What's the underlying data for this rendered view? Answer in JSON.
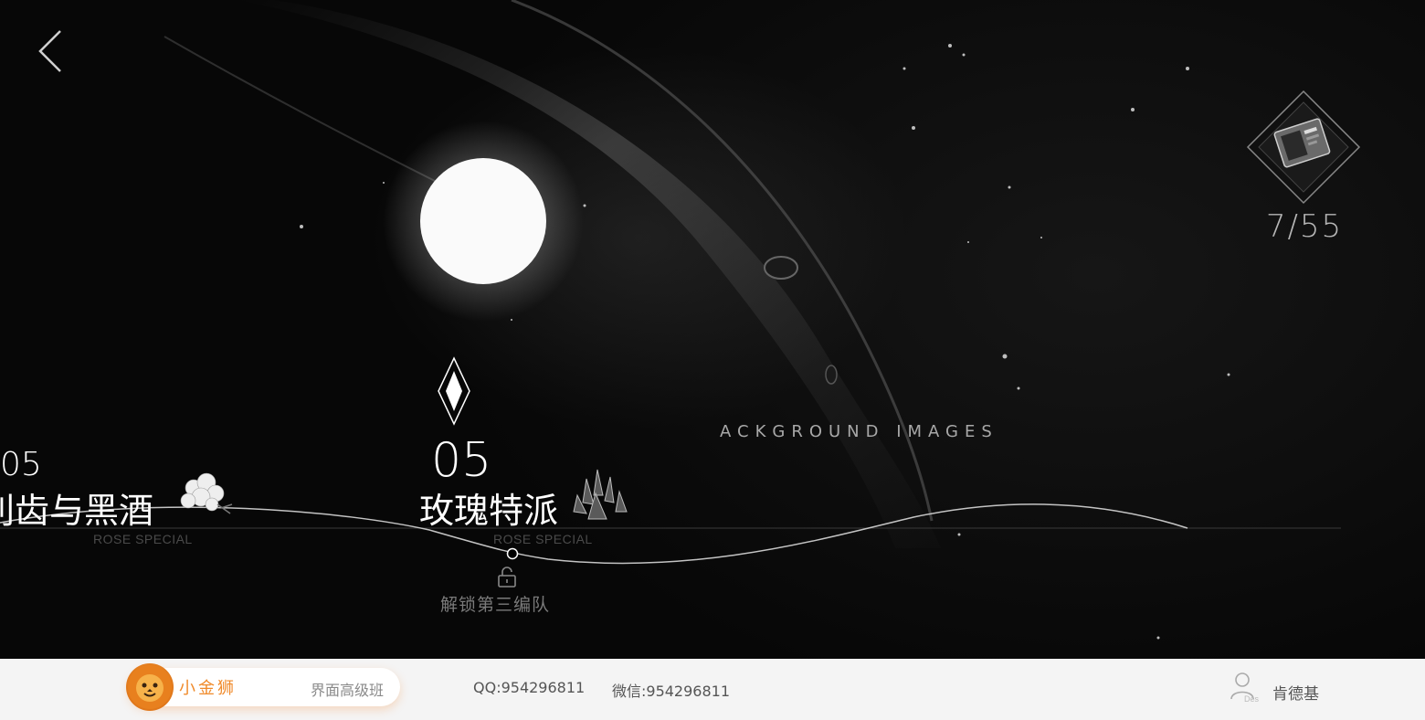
{
  "counter": {
    "current": "7",
    "total": "55",
    "display": "7/55"
  },
  "background_label": "ACKGROUND IMAGES",
  "stages": [
    {
      "number": "05",
      "title": "利齿与黑酒",
      "subtitle": "ROSE SPECIAL",
      "icon": "white-flower-icon"
    },
    {
      "number": "05",
      "title": "玫瑰特派",
      "subtitle": "ROSE SPECIAL",
      "icon": "crystal-cluster-icon"
    }
  ],
  "unlock": {
    "text": "解锁第三编队",
    "icon": "unlock-icon"
  },
  "footer": {
    "brand_name": "小金狮",
    "course": "界面高级班",
    "qq": "QQ:954296811",
    "wechat": "微信:954296811",
    "user_badge": "Des",
    "user_name": "肯德基"
  },
  "colors": {
    "brand_orange": "#F08A2A",
    "footer_bg": "#F4F4F4",
    "scene_bg": "#0A0A0A"
  }
}
